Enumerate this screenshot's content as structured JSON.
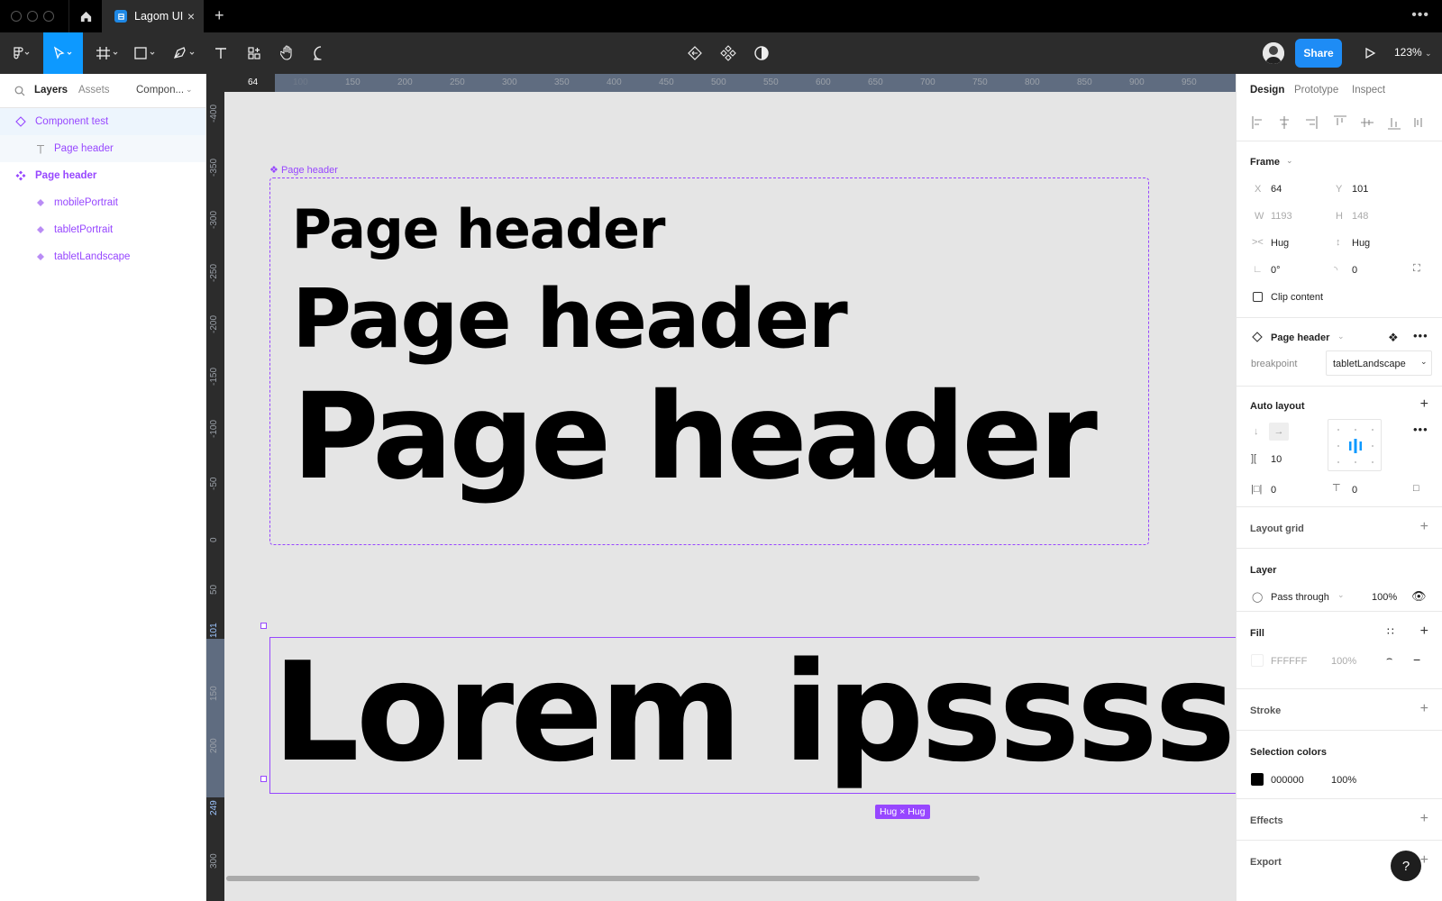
{
  "window": {
    "tab_title": "Lagom UI",
    "close_glyph": "×",
    "new_tab_glyph": "+",
    "more_glyph": "•••"
  },
  "toolbar": {
    "tools": [
      "figma-menu-icon",
      "move-icon",
      "frame-icon",
      "shape-icon",
      "pen-icon",
      "text-icon",
      "resources-icon",
      "hand-icon",
      "comment-icon"
    ],
    "center_tools": [
      "component-swap-icon",
      "component-icon",
      "contrast-icon"
    ],
    "share_label": "Share",
    "zoom": "123%",
    "accent": "#1e8cf5"
  },
  "left_panel": {
    "tabs": {
      "layers": "Layers",
      "assets": "Assets",
      "pages": "Compon..."
    },
    "layers": [
      {
        "label": "Component test",
        "kind": "component-set-icon"
      },
      {
        "label": "Page header",
        "kind": "text-icon"
      },
      {
        "label": "Page header",
        "kind": "component-icon"
      },
      {
        "label": "mobilePortrait",
        "kind": "variant-icon"
      },
      {
        "label": "tabletPortrait",
        "kind": "variant-icon"
      },
      {
        "label": "tabletLandscape",
        "kind": "variant-icon"
      }
    ]
  },
  "rulers": {
    "h_marker": "64",
    "h_ticks": [
      "100",
      "150",
      "200",
      "250",
      "300",
      "350",
      "400",
      "450",
      "500",
      "550",
      "600",
      "650",
      "700",
      "750",
      "800",
      "850",
      "900",
      "950"
    ],
    "v_ticks": [
      "-400",
      "-350",
      "-300",
      "-250",
      "-200",
      "-150",
      "-100",
      "-50",
      "0",
      "50",
      "101",
      "150",
      "200",
      "249",
      "300"
    ]
  },
  "canvas": {
    "frame_label": "Page header",
    "headers": [
      "Page header",
      "Page header",
      "Page header"
    ],
    "lorem_text": "Lorem ipssssss",
    "hug_badge": "Hug × Hug",
    "selection_color": "#9747ff"
  },
  "right_panel": {
    "tabs": {
      "design": "Design",
      "prototype": "Prototype",
      "inspect": "Inspect"
    },
    "frame": {
      "title": "Frame",
      "x_label": "X",
      "x": "64",
      "y_label": "Y",
      "y": "101",
      "w_label": "W",
      "w": "1193",
      "h_label": "H",
      "h": "148",
      "hsize": "Hug",
      "vsize": "Hug",
      "rotation": "0°",
      "radius": "0",
      "clip": "Clip content"
    },
    "component": {
      "name": "Page header",
      "prop_label": "breakpoint",
      "prop_value": "tabletLandscape"
    },
    "auto_layout": {
      "title": "Auto layout",
      "gap": "10",
      "pad_h": "0",
      "pad_v": "0"
    },
    "layout_grid": "Layout grid",
    "layer": {
      "title": "Layer",
      "blend": "Pass through",
      "opacity": "100%"
    },
    "fill": {
      "title": "Fill",
      "hex": "FFFFFF",
      "opacity": "100%"
    },
    "stroke": "Stroke",
    "selection_colors": {
      "title": "Selection colors",
      "hex": "000000",
      "opacity": "100%",
      "swatch": "#000000"
    },
    "effects": "Effects",
    "export": "Export",
    "help": "?"
  }
}
